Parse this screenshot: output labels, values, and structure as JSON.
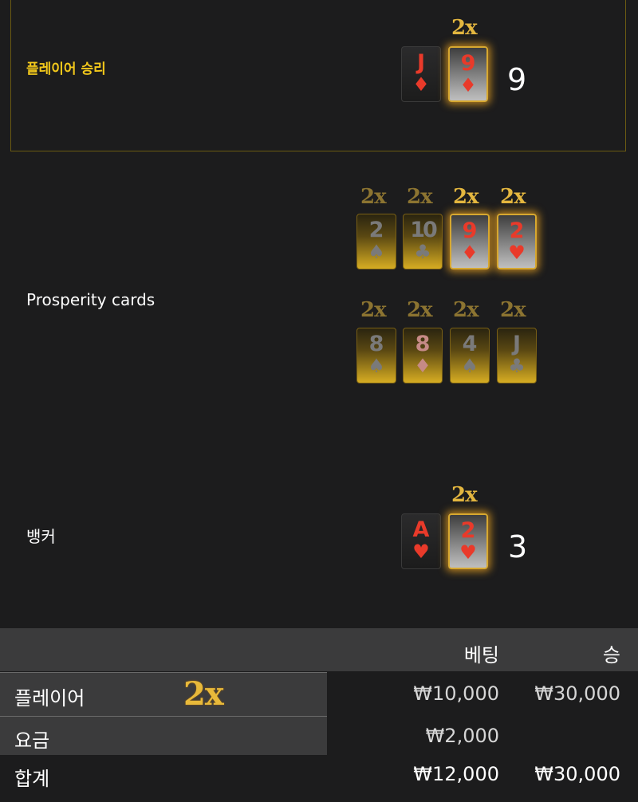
{
  "player": {
    "label": "플레이어 승리",
    "score": "9",
    "cards": [
      {
        "rank": "J",
        "suit": "♦",
        "style": "plain",
        "mult": ""
      },
      {
        "rank": "9",
        "suit": "♦",
        "style": "silver",
        "mult": "2x"
      }
    ]
  },
  "prosperity": {
    "label": "Prosperity cards",
    "row1": [
      {
        "rank": "2",
        "suit": "♠",
        "color": "gray",
        "style": "gold",
        "mult": "2x",
        "active": false
      },
      {
        "rank": "10",
        "suit": "♣",
        "color": "gray",
        "style": "gold",
        "mult": "2x",
        "active": false
      },
      {
        "rank": "9",
        "suit": "♦",
        "color": "red",
        "style": "silver",
        "mult": "2x",
        "active": true
      },
      {
        "rank": "2",
        "suit": "♥",
        "color": "red",
        "style": "silver",
        "mult": "2x",
        "active": true
      }
    ],
    "row2": [
      {
        "rank": "8",
        "suit": "♠",
        "color": "gray",
        "style": "gold",
        "mult": "2x",
        "active": false
      },
      {
        "rank": "8",
        "suit": "♦",
        "color": "pink",
        "style": "gold",
        "mult": "2x",
        "active": false
      },
      {
        "rank": "4",
        "suit": "♠",
        "color": "gray",
        "style": "gold",
        "mult": "2x",
        "active": false
      },
      {
        "rank": "J",
        "suit": "♣",
        "color": "gray",
        "style": "gold",
        "mult": "2x",
        "active": false
      }
    ]
  },
  "banker": {
    "label": "뱅커",
    "score": "3",
    "cards": [
      {
        "rank": "A",
        "suit": "♥",
        "style": "plain",
        "mult": ""
      },
      {
        "rank": "2",
        "suit": "♥",
        "style": "silver",
        "mult": "2x"
      }
    ]
  },
  "table": {
    "headers": {
      "bet": "베팅",
      "win": "승"
    },
    "rows": [
      {
        "label": "플레이어",
        "mult": "2x",
        "bet": "₩10,000",
        "win": "₩30,000"
      },
      {
        "label": "요금",
        "mult": "",
        "bet": "₩2,000",
        "win": ""
      },
      {
        "label": "합계",
        "mult": "",
        "bet": "₩12,000",
        "win": "₩30,000"
      }
    ]
  },
  "colors": {
    "accent": "#f2c81b",
    "gold": "#e3b63f",
    "red": "#e93a2a",
    "bg": "#1c1c1d"
  }
}
